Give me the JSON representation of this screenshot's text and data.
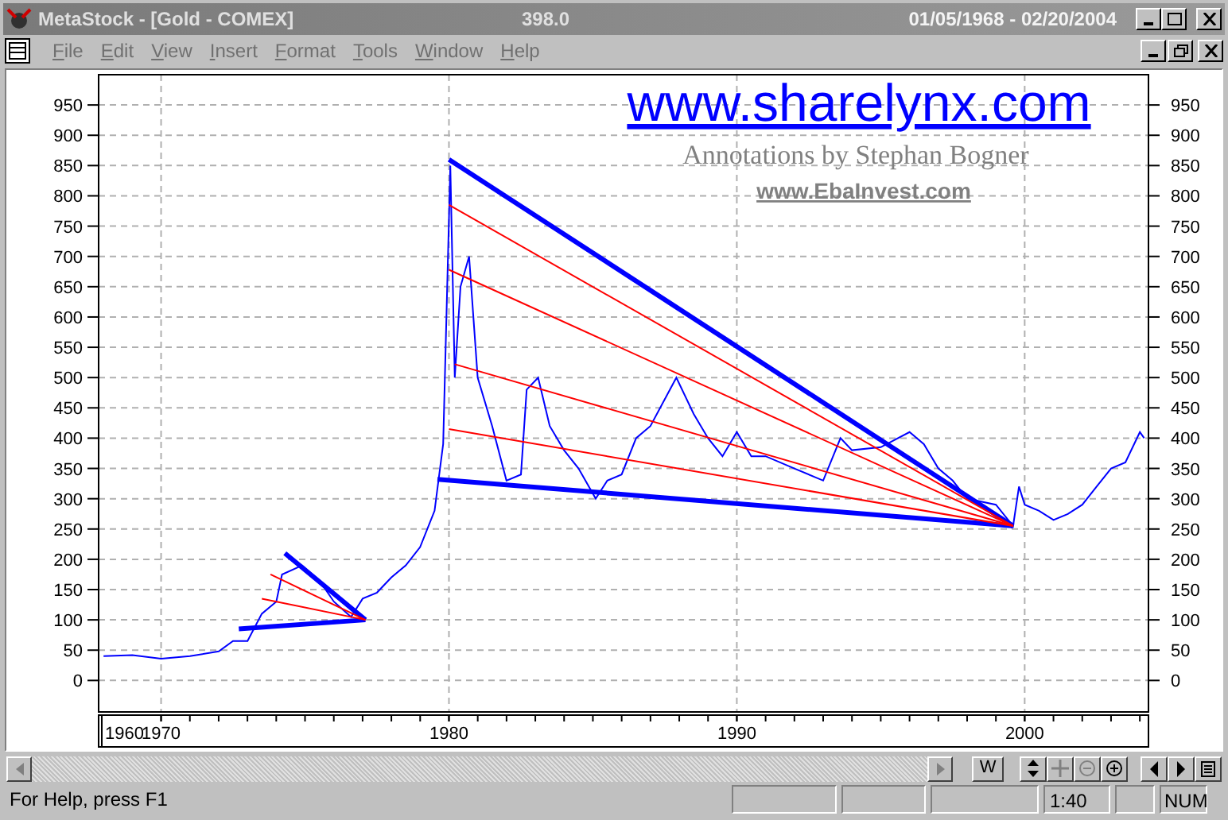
{
  "window": {
    "title": "MetaStock - [Gold - COMEX]",
    "last_price": "398.0",
    "date_range": "01/05/1968 - 02/20/2004"
  },
  "menu": [
    "File",
    "Edit",
    "View",
    "Insert",
    "Format",
    "Tools",
    "Window",
    "Help"
  ],
  "chart": {
    "website": "www.sharelynx.com",
    "credit": "Annotations by Stephan Bogner",
    "link": "www.EbaInvest.com",
    "first_date_label": "1960",
    "right_axis_labels": [
      "950",
      "900",
      "850",
      "800",
      "750",
      "700",
      "650",
      "600",
      "550",
      "500",
      "450",
      "400",
      "350",
      "300",
      "250",
      "200",
      "150",
      "100",
      "50",
      "0"
    ],
    "chart_data": {
      "type": "line",
      "x": [
        1968,
        1969,
        1970,
        1971,
        1972,
        1972.5,
        1973,
        1973.5,
        1974,
        1974.2,
        1974.9,
        1975.5,
        1976,
        1976.6,
        1977,
        1977.5,
        1978,
        1978.5,
        1979,
        1979.5,
        1979.8,
        1980.05,
        1980.2,
        1980.4,
        1980.7,
        1981,
        1981.5,
        1982,
        1982.5,
        1982.7,
        1983.1,
        1983.5,
        1984,
        1984.5,
        1985.1,
        1985.5,
        1986,
        1986.5,
        1987,
        1987.9,
        1988.5,
        1989,
        1989.5,
        1990,
        1990.5,
        1991,
        1992,
        1993,
        1993.6,
        1994,
        1995,
        1996,
        1996.5,
        1997,
        1997.5,
        1998,
        1999,
        1999.6,
        1999.8,
        2000,
        2000.5,
        2001,
        2001.5,
        2002,
        2002.5,
        2003,
        2003.5,
        2004,
        2004.15
      ],
      "series": [
        {
          "color": "#0000ff",
          "values": [
            40,
            42,
            36,
            40,
            48,
            65,
            65,
            110,
            130,
            175,
            190,
            165,
            130,
            105,
            135,
            145,
            170,
            190,
            220,
            280,
            390,
            850,
            500,
            650,
            700,
            500,
            420,
            330,
            340,
            480,
            500,
            420,
            380,
            350,
            300,
            330,
            340,
            400,
            420,
            500,
            440,
            400,
            370,
            410,
            370,
            370,
            350,
            330,
            400,
            380,
            385,
            410,
            390,
            350,
            330,
            300,
            290,
            255,
            320,
            290,
            280,
            265,
            275,
            290,
            320,
            350,
            360,
            410,
            400
          ]
        }
      ],
      "xlim": [
        1967.83,
        2004.3
      ],
      "ylim": [
        -52,
        1000
      ],
      "grid": true,
      "xticks": [
        1970,
        1980,
        1990,
        2000
      ],
      "yticks": [
        0,
        50,
        100,
        150,
        200,
        250,
        300,
        350,
        400,
        450,
        500,
        550,
        600,
        650,
        700,
        750,
        800,
        850,
        900,
        950
      ]
    }
  },
  "toolbar": {
    "width_button": "W"
  },
  "status_bar": {
    "message": "For Help, press F1",
    "scale": "1:40",
    "num_lock": "NUM"
  }
}
